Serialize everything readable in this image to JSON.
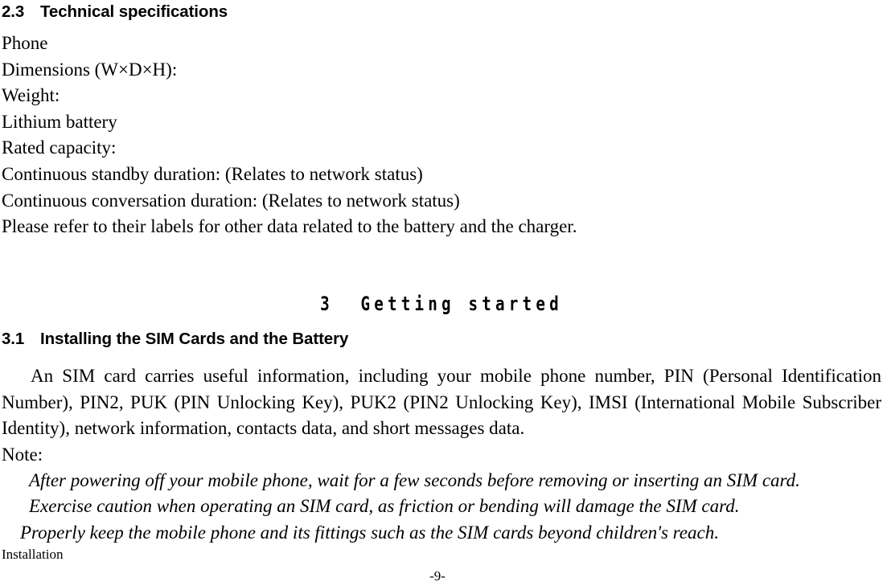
{
  "document": {
    "section_2_3": {
      "number": "2.3",
      "tab": "\t",
      "title": "Technical specifications",
      "spec_lines": [
        "Phone",
        "Dimensions (W×D×H):",
        "Weight:",
        "Lithium battery",
        "Rated capacity:",
        "Continuous standby duration: (Relates to network status)",
        "Continuous conversation duration: (Relates to network status)",
        "Please refer to their labels for other data related to the battery and the charger."
      ]
    },
    "chapter_3": {
      "heading": "3  Getting started"
    },
    "section_3_1": {
      "number": "3.1",
      "title": "Installing the SIM Cards and the Battery",
      "paragraph": "An SIM card carries useful information, including your mobile phone number, PIN (Personal Identification Number), PIN2, PUK (PIN Unlocking Key), PUK2 (PIN2 Unlocking Key), IMSI (International Mobile Subscriber Identity), network information, contacts data, and short messages data.",
      "note_label": "Note:",
      "notes": [
        "After powering off your mobile phone, wait for a few seconds before removing or inserting an SIM card.",
        "Exercise caution when operating an SIM card, as friction or bending will damage the SIM card.",
        "Properly keep the mobile phone and its fittings such as the SIM cards beyond children's reach."
      ]
    },
    "footer": {
      "label": "Installation",
      "page_number": "-9-"
    }
  }
}
